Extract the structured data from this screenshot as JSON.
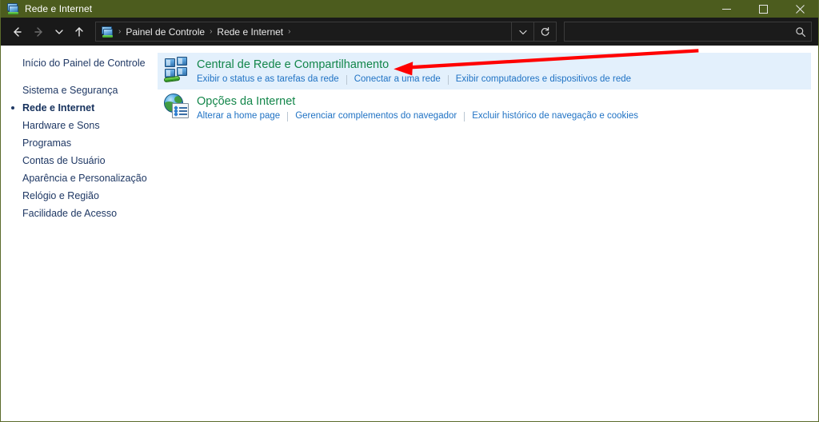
{
  "window": {
    "title": "Rede e Internet",
    "title_icon": "network-computer-icon",
    "controls": {
      "minimize": "Minimizar",
      "maximize": "Maximizar",
      "close": "Fechar"
    },
    "colors": {
      "titlebar": "#4c5c1e",
      "navbar": "#191919",
      "highlight": "#e3f0fc",
      "heading": "#13864a",
      "link": "#1f72c4",
      "sidebar_text": "#1f3864",
      "annotation": "#ff0000"
    }
  },
  "nav": {
    "back": "Voltar",
    "forward": "Avançar",
    "recent": "Locais recentes",
    "up": "Acima",
    "dropdown": "Histórico de locais anteriores",
    "refresh": "Atualizar",
    "breadcrumb_icon": "control-panel-icon",
    "breadcrumbs": [
      "Painel de Controle",
      "Rede e Internet"
    ],
    "separator": "›"
  },
  "search": {
    "value": "",
    "placeholder": "",
    "icon": "search-icon"
  },
  "sidebar": {
    "home": "Início do Painel de Controle",
    "items": [
      {
        "label": "Sistema e Segurança",
        "selected": false
      },
      {
        "label": "Rede e Internet",
        "selected": true
      },
      {
        "label": "Hardware e Sons",
        "selected": false
      },
      {
        "label": "Programas",
        "selected": false
      },
      {
        "label": "Contas de Usuário",
        "selected": false
      },
      {
        "label": "Aparência e Personalização",
        "selected": false
      },
      {
        "label": "Relógio e Região",
        "selected": false
      },
      {
        "label": "Facilidade de Acesso",
        "selected": false
      }
    ]
  },
  "content": {
    "categories": [
      {
        "icon": "network-sharing-center-icon",
        "title": "Central de Rede e Compartilhamento",
        "highlighted": true,
        "links": [
          "Exibir o status e as tarefas da rede",
          "Conectar a uma rede",
          "Exibir computadores e dispositivos de rede"
        ]
      },
      {
        "icon": "internet-options-icon",
        "title": "Opções da Internet",
        "highlighted": false,
        "links": [
          "Alterar a home page",
          "Gerenciar complementos do navegador",
          "Excluir histórico de navegação e cookies"
        ]
      }
    ]
  },
  "annotation": {
    "type": "arrow",
    "direction": "left",
    "color": "#ff0000",
    "points_to": "Central de Rede e Compartilhamento"
  }
}
